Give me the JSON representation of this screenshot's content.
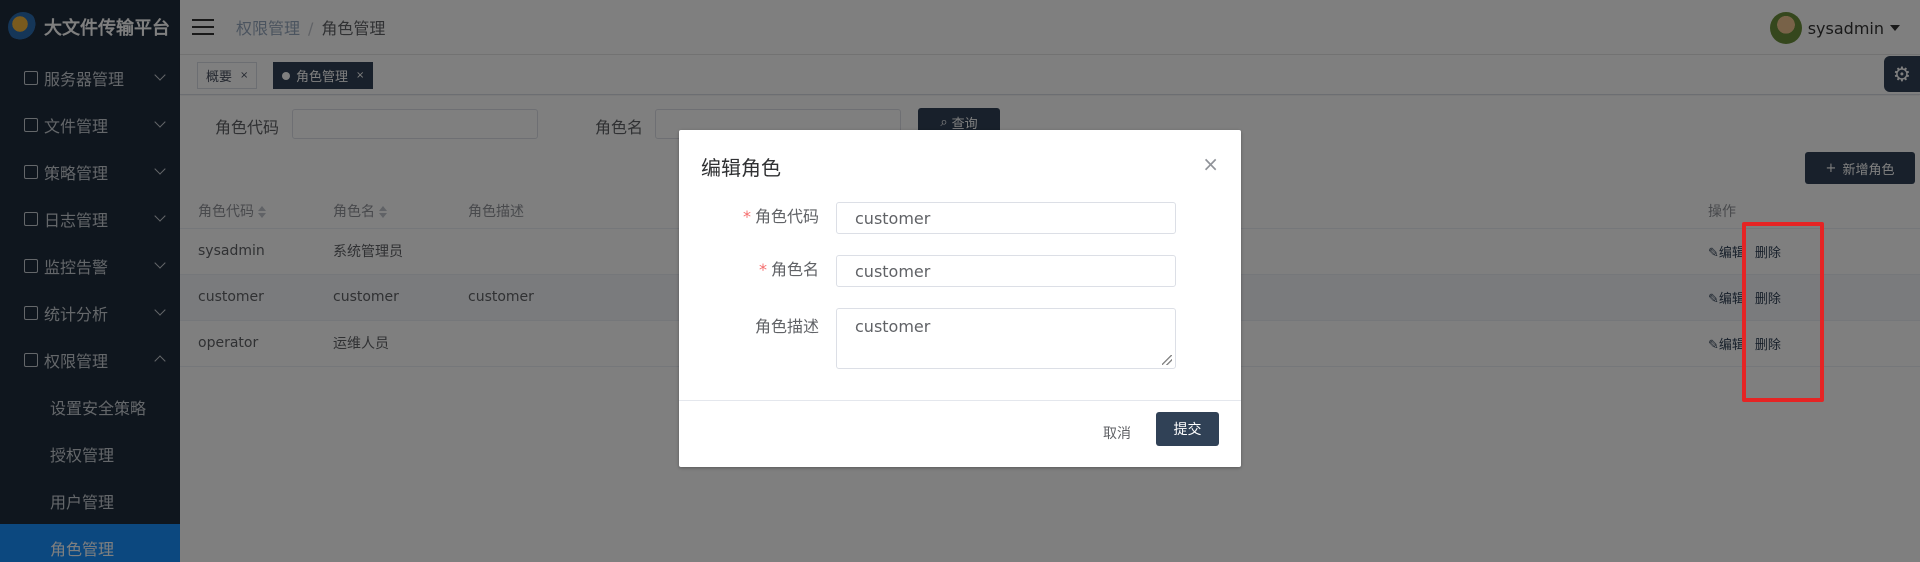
{
  "app": {
    "title": "大文件传输平台"
  },
  "sidebar": {
    "items": [
      {
        "label": "服务器管理",
        "icon": "server-icon"
      },
      {
        "label": "文件管理",
        "icon": "file-icon"
      },
      {
        "label": "策略管理",
        "icon": "policy-icon"
      },
      {
        "label": "日志管理",
        "icon": "log-icon"
      },
      {
        "label": "监控告警",
        "icon": "monitor-icon"
      },
      {
        "label": "统计分析",
        "icon": "chart-icon"
      },
      {
        "label": "权限管理",
        "icon": "permission-icon",
        "expanded": true
      }
    ],
    "subitems": [
      {
        "label": "设置安全策略"
      },
      {
        "label": "授权管理"
      },
      {
        "label": "用户管理"
      },
      {
        "label": "角色管理",
        "active": true
      }
    ]
  },
  "header": {
    "breadcrumb": {
      "parent": "权限管理",
      "separator": "/",
      "current": "角色管理"
    },
    "user": "sysadmin"
  },
  "tags": [
    {
      "label": "概要",
      "close": "×"
    },
    {
      "label": "角色管理",
      "close": "×",
      "active": true
    }
  ],
  "search": {
    "code_label": "角色代码",
    "name_label": "角色名",
    "button": "查询"
  },
  "toolbar": {
    "add_button": "新增角色"
  },
  "table": {
    "headers": {
      "code": "角色代码",
      "name": "角色名",
      "desc": "角色描述",
      "ops": "操作"
    },
    "rows": [
      {
        "code": "sysadmin",
        "name": "系统管理员",
        "desc": "",
        "edit": "编辑",
        "delete": "删除"
      },
      {
        "code": "customer",
        "name": "customer",
        "desc": "customer",
        "edit": "编辑",
        "delete": "删除"
      },
      {
        "code": "operator",
        "name": "运维人员",
        "desc": "",
        "edit": "编辑",
        "delete": "删除"
      }
    ]
  },
  "dialog": {
    "title": "编辑角色",
    "close": "×",
    "fields": {
      "code": {
        "label": "角色代码",
        "required": "*",
        "value": "customer"
      },
      "name": {
        "label": "角色名",
        "required": "*",
        "value": "customer"
      },
      "desc": {
        "label": "角色描述",
        "value": "customer"
      }
    },
    "cancel": "取消",
    "submit": "提交"
  },
  "colors": {
    "sidebar_bg": "#1f2d3d",
    "accent": "#304156",
    "highlight": "#e52424"
  }
}
